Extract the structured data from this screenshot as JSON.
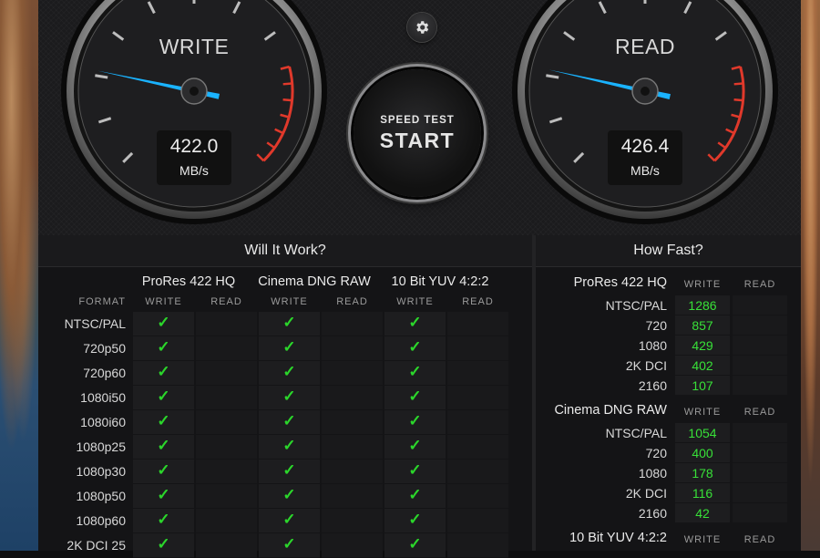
{
  "gauges": {
    "write": {
      "label": "WRITE",
      "value": "422.0",
      "unit": "MB/s",
      "speed": 422.0
    },
    "read": {
      "label": "READ",
      "value": "426.4",
      "unit": "MB/s",
      "speed": 426.4
    }
  },
  "start_button": {
    "line1": "SPEED TEST",
    "line2": "START"
  },
  "settings_icon": "gear-icon",
  "colors": {
    "needle": "#1ab3ff",
    "redline": "#e0392b",
    "check": "#2bd62b",
    "value": "#38e038"
  },
  "will_it_work": {
    "title": "Will It Work?",
    "format_label": "FORMAT",
    "write_label": "WRITE",
    "read_label": "READ",
    "codecs": [
      "ProRes 422 HQ",
      "Cinema DNG RAW",
      "10 Bit YUV 4:2:2"
    ],
    "formats": [
      "NTSC/PAL",
      "720p50",
      "720p60",
      "1080i50",
      "1080i60",
      "1080p25",
      "1080p30",
      "1080p50",
      "1080p60",
      "2K DCI 25"
    ],
    "check_symbol": "✓"
  },
  "how_fast": {
    "title": "How Fast?",
    "write_label": "WRITE",
    "read_label": "READ",
    "groups": [
      {
        "codec": "ProRes 422 HQ",
        "rows": [
          {
            "format": "NTSC/PAL",
            "write": "1286"
          },
          {
            "format": "720",
            "write": "857"
          },
          {
            "format": "1080",
            "write": "429"
          },
          {
            "format": "2K DCI",
            "write": "402"
          },
          {
            "format": "2160",
            "write": "107"
          }
        ]
      },
      {
        "codec": "Cinema DNG RAW",
        "rows": [
          {
            "format": "NTSC/PAL",
            "write": "1054"
          },
          {
            "format": "720",
            "write": "400"
          },
          {
            "format": "1080",
            "write": "178"
          },
          {
            "format": "2K DCI",
            "write": "116"
          },
          {
            "format": "2160",
            "write": "42"
          }
        ]
      },
      {
        "codec": "10 Bit YUV 4:2:2",
        "rows": []
      }
    ]
  }
}
